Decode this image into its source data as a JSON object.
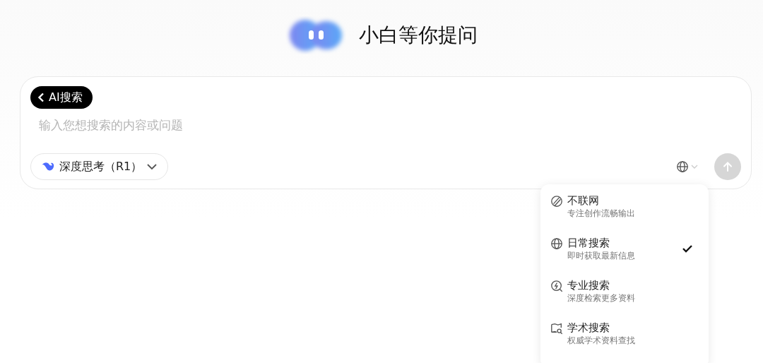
{
  "header": {
    "title": "小白等你提问"
  },
  "composer": {
    "mode_chip": "AI搜索",
    "placeholder": "输入您想搜索的内容或问题",
    "model_button": "深度思考（R1）"
  },
  "search_menu": {
    "expanded": true,
    "items": [
      {
        "kind": "offline",
        "title": "不联网",
        "subtitle": "专注创作流畅输出",
        "selected": false
      },
      {
        "kind": "web",
        "title": "日常搜索",
        "subtitle": "即时获取最新信息",
        "selected": true
      },
      {
        "kind": "pro",
        "title": "专业搜索",
        "subtitle": "深度检索更多资料",
        "selected": false
      },
      {
        "kind": "academic",
        "title": "学术搜索",
        "subtitle": "权威学术资料查找",
        "selected": false
      }
    ]
  }
}
